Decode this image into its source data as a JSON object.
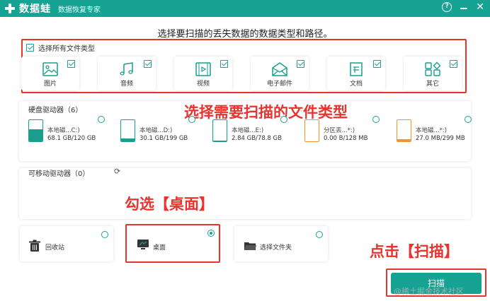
{
  "app": {
    "name": "数据蛙",
    "subtitle": "数据恢复专家"
  },
  "window": {
    "help_icon": "help-circle-icon",
    "minimize_icon": "minimize-icon",
    "close_icon": "close-icon"
  },
  "heading": "选择要扫描的丢失数据的数据类型和路径。",
  "file_types": {
    "select_all_label": "选择所有文件类型",
    "select_all_checked": true,
    "items": [
      {
        "label": "图片",
        "icon": "image-icon",
        "checked": true
      },
      {
        "label": "音频",
        "icon": "music-icon",
        "checked": true
      },
      {
        "label": "视频",
        "icon": "video-icon",
        "checked": true
      },
      {
        "label": "电子邮件",
        "icon": "email-icon",
        "checked": true
      },
      {
        "label": "文档",
        "icon": "document-icon",
        "checked": true
      },
      {
        "label": "其它",
        "icon": "other-icon",
        "checked": true
      }
    ]
  },
  "annotations": {
    "file_type": "选择需要扫描的文件类型",
    "desktop": "勾选【桌面】",
    "scan": "点击【扫描】"
  },
  "hard_drives": {
    "title": "硬盘驱动器（6）",
    "items": [
      {
        "name": "本地磁...C:)",
        "size": "68.1 GB/120 GB",
        "fill_fraction": 0.57,
        "color": "teal"
      },
      {
        "name": "本地磁...D:)",
        "size": "30.1 GB/199 GB",
        "fill_fraction": 0.15,
        "color": "teal"
      },
      {
        "name": "本地磁...E:)",
        "size": "2.84 GB/78.8 GB",
        "fill_fraction": 0.04,
        "color": "teal"
      },
      {
        "name": "分区丢...*:)",
        "size": "0.00  B/128 MB",
        "fill_fraction": 0.0,
        "color": "orange"
      },
      {
        "name": "本地磁...*:)",
        "size": "27.0 MB/299 MB",
        "fill_fraction": 0.09,
        "color": "orange"
      }
    ]
  },
  "removable": {
    "title": "可移动驱动器（0）",
    "refresh_icon": "refresh-icon"
  },
  "locations": [
    {
      "label": "回收站",
      "icon": "recycle-bin-icon",
      "selected": false
    },
    {
      "label": "桌面",
      "icon": "desktop-icon",
      "selected": true
    },
    {
      "label": "选择文件夹",
      "icon": "folder-icon",
      "selected": false
    }
  ],
  "scan_button": "扫描",
  "watermark": "@稀土掘金技术社区",
  "colors": {
    "accent": "#17a394",
    "annotation": "#e8332f",
    "drive_teal": "#1a9e8e",
    "drive_orange": "#f0962b"
  }
}
